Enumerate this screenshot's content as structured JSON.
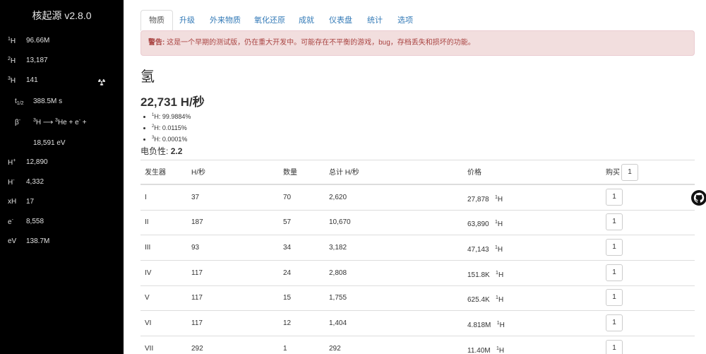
{
  "sidebar": {
    "title": "核起源 v2.8.0",
    "rows": [
      {
        "sup": "1",
        "label": "H",
        "value": "96.66M"
      },
      {
        "sup": "2",
        "label": "H",
        "value": "13,187"
      },
      {
        "sup": "3",
        "label": "H",
        "value": "141"
      }
    ],
    "halflife": {
      "label": "t",
      "sub": "1/2",
      "value": "388.5M s"
    },
    "decay": {
      "label": "β",
      "sup": "-",
      "equation_a": "H ⟶ ",
      "equation_b": "He + e",
      "equation_c": " +",
      "sup_a": "3",
      "sup_b": "3",
      "sup_c": "-"
    },
    "decay_energy": "18,591 eV",
    "particles": [
      {
        "label": "H",
        "sup": "+",
        "value": "12,890"
      },
      {
        "label": "H",
        "sup": "-",
        "value": "4,332"
      },
      {
        "label": "xH",
        "sup": "",
        "value": "17"
      },
      {
        "label": "e",
        "sup": "-",
        "value": "8,558"
      },
      {
        "label": "eV",
        "sup": "",
        "value": "138.7M"
      }
    ]
  },
  "tabs": [
    "物质",
    "升级",
    "外来物质",
    "氧化还原",
    "成就",
    "仪表盘",
    "统计",
    "选项"
  ],
  "alert": {
    "strong": "警告:",
    "text": " 这是一个早期的测试版，仍在重大开发中。可能存在不平衡的游戏，bug，存档丢失和损坏的功能。"
  },
  "element": {
    "name": "氢",
    "rate": "22,731 H/秒",
    "electronegativity_label": "电负性:",
    "electronegativity_value": "2.2"
  },
  "isotopes": [
    {
      "sup": "1",
      "text": "H: 99.9884%"
    },
    {
      "sup": "2",
      "text": "H: 0.0115%"
    },
    {
      "sup": "3",
      "text": "H: 0.0001%"
    }
  ],
  "table": {
    "headers": [
      "发生器",
      "H/秒",
      "数量",
      "总计 H/秒",
      "价格",
      "购买"
    ],
    "buy_amount": "1",
    "price_unit_sup": "1",
    "price_unit": "H",
    "rows": [
      {
        "gen": "I",
        "rate": "37",
        "count": "70",
        "total": "2,620",
        "price": "27,878",
        "buy": "1"
      },
      {
        "gen": "II",
        "rate": "187",
        "count": "57",
        "total": "10,670",
        "price": "63,890",
        "buy": "1"
      },
      {
        "gen": "III",
        "rate": "93",
        "count": "34",
        "total": "3,182",
        "price": "47,143",
        "buy": "1"
      },
      {
        "gen": "IV",
        "rate": "117",
        "count": "24",
        "total": "2,808",
        "price": "151.8K",
        "buy": "1"
      },
      {
        "gen": "V",
        "rate": "117",
        "count": "15",
        "total": "1,755",
        "price": "625.4K",
        "buy": "1"
      },
      {
        "gen": "VI",
        "rate": "117",
        "count": "12",
        "total": "1,404",
        "price": "4.818M",
        "buy": "1"
      },
      {
        "gen": "VII",
        "rate": "292",
        "count": "1",
        "total": "292",
        "price": "11.40M",
        "buy": "1"
      }
    ]
  },
  "icons": {
    "radiation": "radiation-icon",
    "github": "github-icon"
  }
}
